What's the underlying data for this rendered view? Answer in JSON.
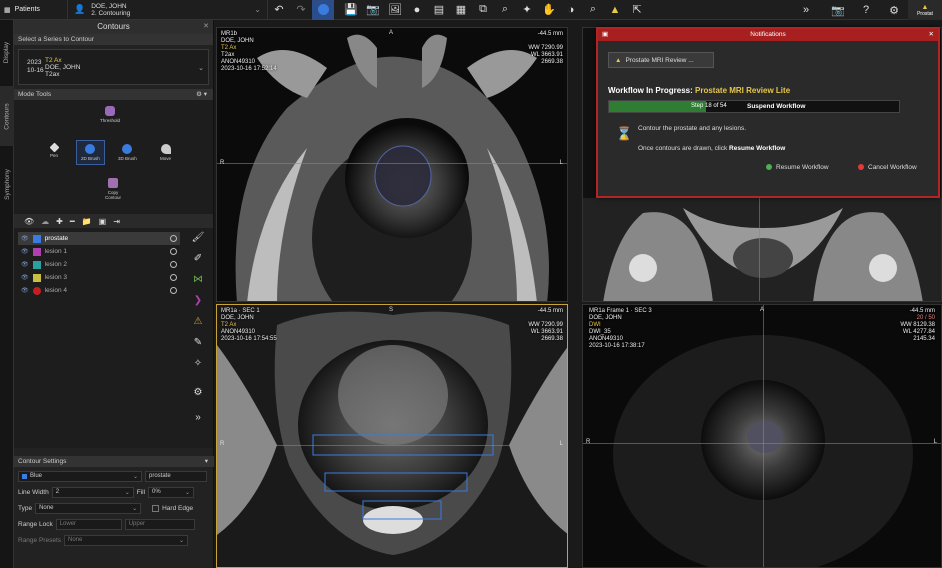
{
  "toolbar": {
    "patients_label": "Patients",
    "patient_name": "DOE, JOHN",
    "workflow_step": "2. Contouring",
    "prostate_tab_label": "Prostat"
  },
  "vtabs": [
    "Display",
    "Contours",
    "Symphony"
  ],
  "contours_panel": {
    "title": "Contours",
    "select_series_header": "Select a Series to Contour",
    "series": {
      "year": "2023",
      "date": "10-16",
      "name": "T2 Ax",
      "patient": "DOE, JOHN",
      "desc": "T2ax"
    },
    "mode_tools_header": "Mode Tools",
    "mode_tools": [
      {
        "label": "Threshold"
      },
      {
        "label": "Pen"
      },
      {
        "label": "2D Brush"
      },
      {
        "label": "3D Brush"
      },
      {
        "label": "Move"
      },
      {
        "label": "Copy Contour"
      }
    ],
    "rois": [
      {
        "name": "prostate",
        "color": "#3a7be0"
      },
      {
        "name": "lesion 1",
        "color": "#b040b0"
      },
      {
        "name": "lesion 2",
        "color": "#2aa0a0"
      },
      {
        "name": "lesion 3",
        "color": "#c8c040"
      },
      {
        "name": "lesion 4",
        "color": "#c02020"
      }
    ]
  },
  "contour_settings": {
    "header": "Contour Settings",
    "color_label": "Blue",
    "roi_name": "prostate",
    "line_width_label": "Line Width",
    "line_width_value": "2",
    "fill_label": "Fill",
    "fill_value": "0%",
    "type_label": "Type",
    "type_value": "None",
    "hard_edge_label": "Hard Edge",
    "range_lock_label": "Range Lock",
    "lower_placeholder": "Lower",
    "upper_placeholder": "Upper",
    "range_presets_label": "Range Presets",
    "range_presets_value": "None"
  },
  "viewports": {
    "tl": {
      "series": "MR1b",
      "patient": "DOE, JOHN",
      "seq": "T2 Ax",
      "desc": "T2ax",
      "anon": "ANON49310",
      "datetime": "2023-10-16 17:52:14",
      "pos": "-44.5 mm",
      "ww": "WW 7290.99",
      "wl": "WL 3663.91",
      "val": "2669.38"
    },
    "bl": {
      "series": "MR1a · SEC 1",
      "patient": "DOE, JOHN",
      "seq": "T2 Ax",
      "anon": "ANON49310",
      "datetime": "2023-10-16 17:54:55",
      "pos": "-44.5 mm",
      "ww": "WW 7290.99",
      "wl": "WL 3663.91",
      "val": "2669.38"
    },
    "br": {
      "series": "MR1a Frame 1 · SEC 3",
      "patient": "DOE, JOHN",
      "seq": "DWI",
      "desc": "DWI_35",
      "anon": "ANON49310",
      "datetime": "2023-10-16 17:38:17",
      "pos": "-44.5 mm",
      "slice": "20 / 50",
      "ww": "WW 8129.38",
      "wl": "WL 4277.84",
      "val": "2145.34"
    }
  },
  "notification": {
    "title": "Notifications",
    "button_label": "Prostate MRI Review ...",
    "wf_prefix": "Workflow In Progress:",
    "wf_name": "Prostate MRI Review Lite",
    "step_label": "Step 18 of 54",
    "progress_fraction": 0.333,
    "suspend_label": "Suspend Workflow",
    "msg1": "Contour the prostate and any lesions.",
    "msg2_prefix": "Once contours are drawn, click",
    "msg2_bold": "Resume Workflow",
    "resume_label": "Resume Workflow",
    "cancel_label": "Cancel Workflow"
  },
  "orient": {
    "a": "A",
    "l": "L",
    "r": "R",
    "s": "S"
  }
}
